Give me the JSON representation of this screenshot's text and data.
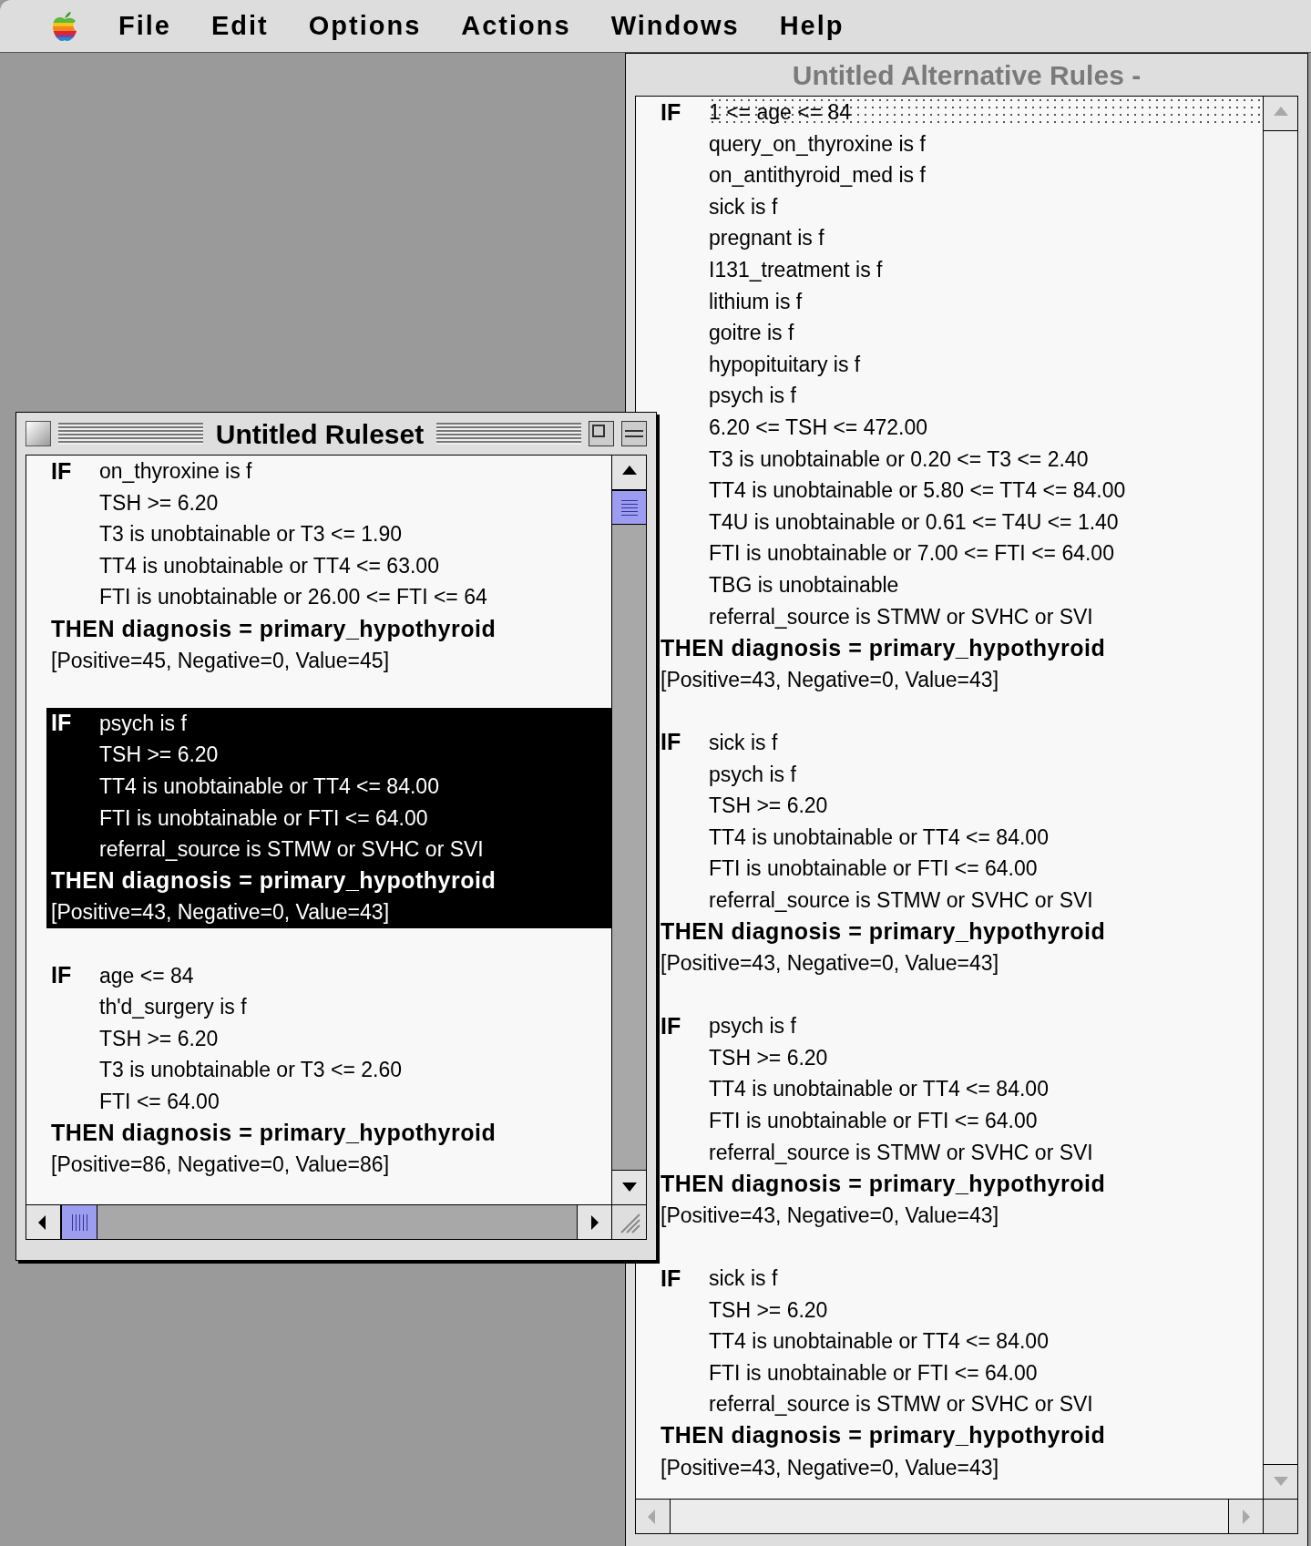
{
  "menu_bar": {
    "items": [
      "File",
      "Edit",
      "Options",
      "Actions",
      "Windows",
      "Help"
    ]
  },
  "alternative_rules_window": {
    "title": "Untitled Alternative Rules -",
    "active": false,
    "rules": [
      {
        "if_label": "IF",
        "selected": false,
        "conditions": [
          {
            "text": "1 <= age <= 84",
            "selected": true
          },
          {
            "text": "query_on_thyroxine is f",
            "selected": false
          },
          {
            "text": "on_antithyroid_med is f",
            "selected": false
          },
          {
            "text": "sick is f",
            "selected": false
          },
          {
            "text": "pregnant is f",
            "selected": false
          },
          {
            "text": "I131_treatment is f",
            "selected": false
          },
          {
            "text": "lithium is f",
            "selected": false
          },
          {
            "text": "goitre is f",
            "selected": false
          },
          {
            "text": "hypopituitary is f",
            "selected": false
          },
          {
            "text": "psych is f",
            "selected": false
          },
          {
            "text": "6.20 <= TSH <= 472.00",
            "selected": false
          },
          {
            "text": "T3 is unobtainable or 0.20 <= T3 <= 2.40",
            "selected": false
          },
          {
            "text": "TT4 is unobtainable or 5.80 <= TT4 <= 84.00",
            "selected": false
          },
          {
            "text": "T4U is unobtainable or 0.61 <= T4U <= 1.40",
            "selected": false
          },
          {
            "text": "FTI is unobtainable or 7.00 <= FTI <= 64.00",
            "selected": false
          },
          {
            "text": "TBG is unobtainable",
            "selected": false
          },
          {
            "text": "referral_source is STMW or SVHC or SVI",
            "selected": false
          }
        ],
        "then": "THEN diagnosis = primary_hypothyroid",
        "stats": "[Positive=43, Negative=0, Value=43]"
      },
      {
        "if_label": "IF",
        "selected": false,
        "conditions": [
          {
            "text": "sick is f",
            "selected": false
          },
          {
            "text": "psych is f",
            "selected": false
          },
          {
            "text": "TSH >= 6.20",
            "selected": false
          },
          {
            "text": "TT4 is unobtainable or TT4 <= 84.00",
            "selected": false
          },
          {
            "text": "FTI is unobtainable or FTI <= 64.00",
            "selected": false
          },
          {
            "text": "referral_source is STMW or SVHC or SVI",
            "selected": false
          }
        ],
        "then": "THEN diagnosis = primary_hypothyroid",
        "stats": "[Positive=43, Negative=0, Value=43]"
      },
      {
        "if_label": "IF",
        "selected": false,
        "conditions": [
          {
            "text": "psych is f",
            "selected": false
          },
          {
            "text": "TSH >= 6.20",
            "selected": false
          },
          {
            "text": "TT4 is unobtainable or TT4 <= 84.00",
            "selected": false
          },
          {
            "text": "FTI is unobtainable or FTI <= 64.00",
            "selected": false
          },
          {
            "text": "referral_source is STMW or SVHC or SVI",
            "selected": false
          }
        ],
        "then": "THEN diagnosis = primary_hypothyroid",
        "stats": "[Positive=43, Negative=0, Value=43]"
      },
      {
        "if_label": "IF",
        "selected": false,
        "conditions": [
          {
            "text": "sick is f",
            "selected": false
          },
          {
            "text": "TSH >= 6.20",
            "selected": false
          },
          {
            "text": "TT4 is unobtainable or TT4 <= 84.00",
            "selected": false
          },
          {
            "text": "FTI is unobtainable or FTI <= 64.00",
            "selected": false
          },
          {
            "text": "referral_source is STMW or SVHC or SVI",
            "selected": false
          }
        ],
        "then": "THEN diagnosis = primary_hypothyroid",
        "stats": "[Positive=43, Negative=0, Value=43]"
      }
    ]
  },
  "ruleset_window": {
    "title": "Untitled Ruleset",
    "active": true,
    "rules": [
      {
        "if_label": "IF",
        "selected": false,
        "conditions": [
          {
            "text": "on_thyroxine is f",
            "selected": false
          },
          {
            "text": "TSH >= 6.20",
            "selected": false
          },
          {
            "text": "T3 is unobtainable or T3 <= 1.90",
            "selected": false
          },
          {
            "text": "TT4 is unobtainable or TT4 <= 63.00",
            "selected": false
          },
          {
            "text": "FTI is unobtainable or 26.00 <= FTI <= 64",
            "selected": false
          }
        ],
        "then": "THEN diagnosis = primary_hypothyroid",
        "stats": "[Positive=45, Negative=0, Value=45]"
      },
      {
        "if_label": "IF",
        "selected": true,
        "conditions": [
          {
            "text": "psych is f",
            "selected": false
          },
          {
            "text": "TSH >= 6.20",
            "selected": false
          },
          {
            "text": "TT4 is unobtainable or TT4 <= 84.00",
            "selected": false
          },
          {
            "text": "FTI is unobtainable or FTI <= 64.00",
            "selected": false
          },
          {
            "text": "referral_source is STMW or SVHC or SVI",
            "selected": false
          }
        ],
        "then": "THEN diagnosis = primary_hypothyroid",
        "stats": "[Positive=43, Negative=0, Value=43]"
      },
      {
        "if_label": "IF",
        "selected": false,
        "conditions": [
          {
            "text": "age <= 84",
            "selected": false
          },
          {
            "text": "th'd_surgery is f",
            "selected": false
          },
          {
            "text": "TSH >= 6.20",
            "selected": false
          },
          {
            "text": "T3 is unobtainable or T3 <= 2.60",
            "selected": false
          },
          {
            "text": "FTI <= 64.00",
            "selected": false
          }
        ],
        "then": "THEN diagnosis = primary_hypothyroid",
        "stats": "[Positive=86, Negative=0, Value=86]"
      }
    ]
  }
}
